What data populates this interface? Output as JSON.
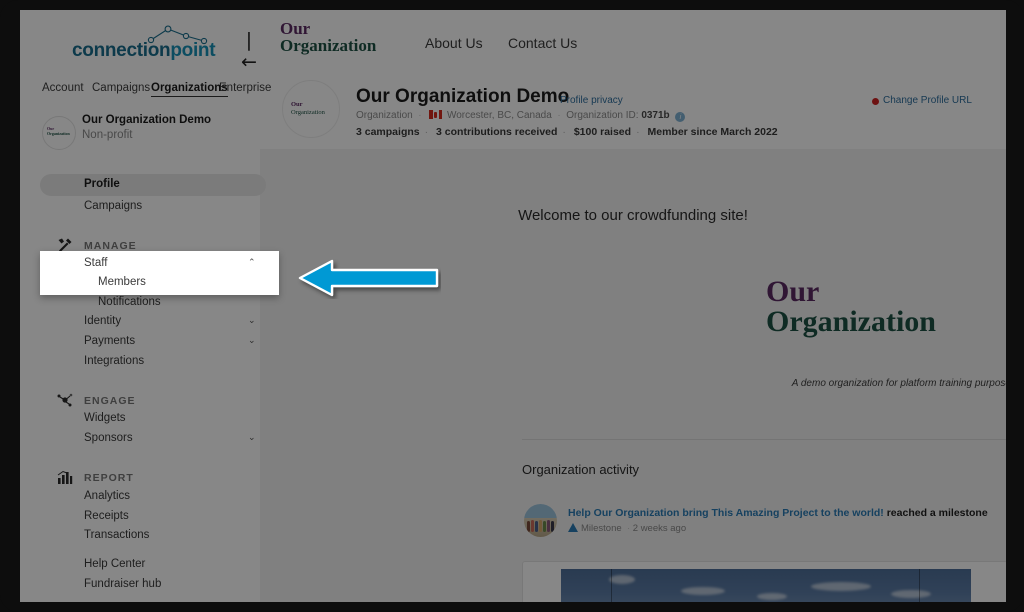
{
  "app": {
    "logo": {
      "part1": "connection",
      "part2": "point"
    },
    "collapse_icon": "collapse-sidebar-icon",
    "collapse_glyph": "|←"
  },
  "topnav": {
    "items": [
      {
        "label": "Account",
        "active": false
      },
      {
        "label": "Campaigns",
        "active": false
      },
      {
        "label": "Organizations",
        "active": true
      },
      {
        "label": "Enterprise",
        "active": false
      }
    ]
  },
  "sidebar": {
    "org": {
      "name": "Our Organization Demo",
      "type": "Non-profit",
      "thumb_line1": "Our",
      "thumb_line2": "Organization"
    },
    "primary": [
      {
        "label": "Profile",
        "active": true
      },
      {
        "label": "Campaigns",
        "active": false
      }
    ],
    "sections": [
      {
        "title": "MANAGE",
        "icon": "tools-icon",
        "items": [
          {
            "label": "Staff",
            "chevron": "⌃",
            "expanded": true
          },
          {
            "label": "Members",
            "sub": true
          },
          {
            "label": "Notifications",
            "sub": true
          },
          {
            "label": "Identity",
            "chevron": "⌄"
          },
          {
            "label": "Payments",
            "chevron": "⌄"
          },
          {
            "label": "Integrations"
          }
        ]
      },
      {
        "title": "ENGAGE",
        "icon": "engage-network-icon",
        "items": [
          {
            "label": "Widgets"
          },
          {
            "label": "Sponsors",
            "chevron": "⌄"
          }
        ]
      },
      {
        "title": "REPORT",
        "icon": "bar-chart-icon",
        "items": [
          {
            "label": "Analytics"
          },
          {
            "label": "Receipts"
          },
          {
            "label": "Transactions"
          }
        ]
      }
    ],
    "footer": [
      {
        "label": "Help Center"
      },
      {
        "label": "Fundraiser hub"
      }
    ]
  },
  "highlight": {
    "staff_label": "Staff",
    "members_label": "Members",
    "chevron": "⌃"
  },
  "site_header": {
    "logo_line1": "Our",
    "logo_line2": "Organization",
    "nav": [
      {
        "label": "About Us"
      },
      {
        "label": "Contact Us"
      }
    ]
  },
  "profile": {
    "avatar_line1": "Our",
    "avatar_line2": "Organization",
    "title": "Our Organization Demo",
    "privacy_link": "Profile privacy",
    "change_url_link": "Change Profile URL",
    "type": "Organization",
    "location": "Worcester, BC, Canada",
    "id_label": "Organization ID:",
    "id_value": "0371b",
    "stats": [
      "3 campaigns",
      "3 contributions received",
      "$100 raised",
      "Member since March 2022"
    ]
  },
  "content": {
    "welcome": "Welcome to our crowdfunding site!",
    "big_logo_line1": "Our",
    "big_logo_line2": "Organization",
    "tagline": "A demo organization for platform training purposes",
    "activity_title": "Organization activity",
    "activity": {
      "link_text": "Help Our Organization bring This Amazing Project to the world!",
      "suffix": " reached a milestone",
      "type": "Milestone",
      "time": "2 weeks ago"
    }
  },
  "annotation": {
    "arrow": "left-pointing-arrow",
    "arrow_color": "#0099d4",
    "arrow_border": "#ffffff"
  },
  "colors": {
    "brand_teal": "#1792b8",
    "org_purple": "#5b2a63",
    "org_green": "#1d5244",
    "link_blue": "#2a7cb5",
    "red_dot": "#cf2222"
  }
}
